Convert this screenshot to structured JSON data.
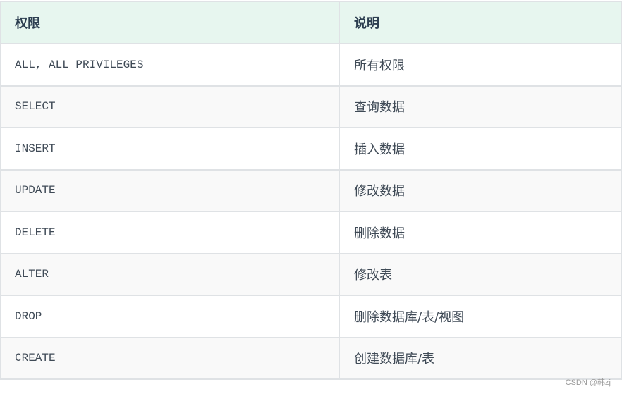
{
  "table": {
    "headers": [
      "权限",
      "说明"
    ],
    "rows": [
      [
        "ALL, ALL PRIVILEGES",
        "所有权限"
      ],
      [
        "SELECT",
        "查询数据"
      ],
      [
        "INSERT",
        "插入数据"
      ],
      [
        "UPDATE",
        "修改数据"
      ],
      [
        "DELETE",
        "删除数据"
      ],
      [
        "ALTER",
        "修改表"
      ],
      [
        "DROP",
        "删除数据库/表/视图"
      ],
      [
        "CREATE",
        "创建数据库/表"
      ]
    ]
  },
  "watermark": "CSDN @韩zj",
  "colors": {
    "header_bg": "#e7f6ef",
    "border": "#dfe2e5",
    "alt_row": "#f9f9f9"
  }
}
